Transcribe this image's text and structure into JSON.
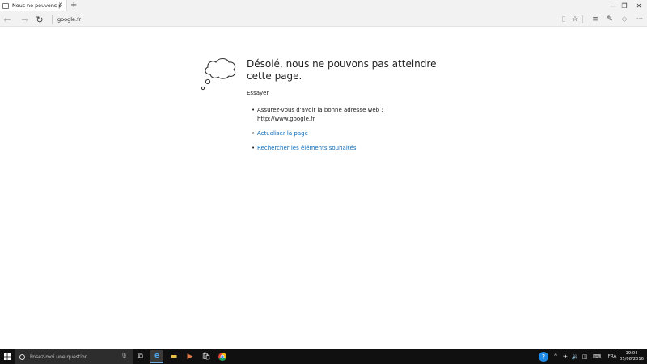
{
  "browser": {
    "tab_title": "Nous ne pouvons pas at",
    "address": "google.fr"
  },
  "error_page": {
    "title": "Désolé, nous ne pouvons pas atteindre cette page.",
    "subtitle": "Essayer",
    "suggestion_1_line1": "Assurez-vous d'avoir la bonne adresse web :",
    "suggestion_1_line2": "http://www.google.fr",
    "link_refresh": "Actualiser la page",
    "link_search": "Rechercher les éléments souhaités",
    "link_color": "#0b6bb8"
  },
  "taskbar": {
    "search_placeholder": "Posez-moi une question.",
    "language": "FRA",
    "time": "19:04",
    "date": "05/08/2016"
  }
}
